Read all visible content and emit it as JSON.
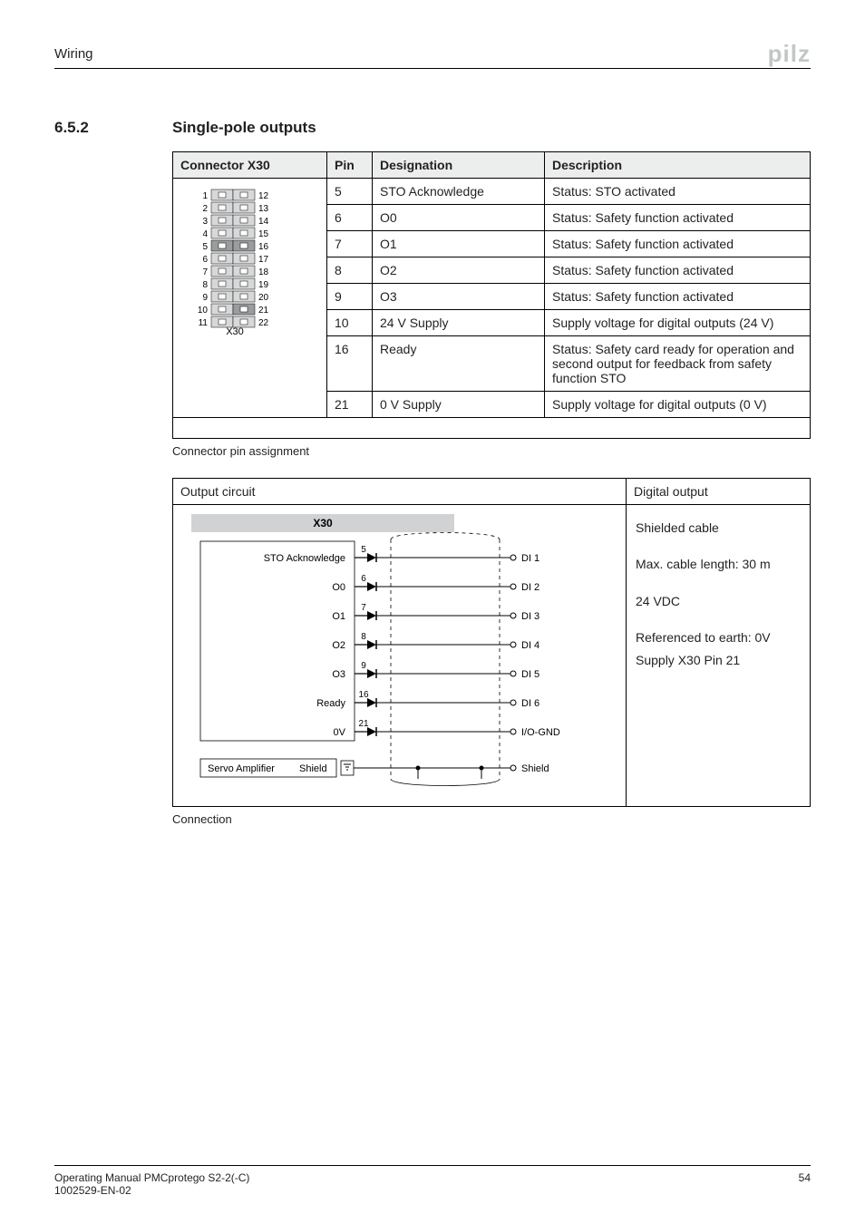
{
  "header": {
    "section": "Wiring",
    "brand": "pilz"
  },
  "section": {
    "number": "6.5.2",
    "title": "Single-pole outputs"
  },
  "pin_table": {
    "headers": [
      "Connector X30",
      "Pin",
      "Designation",
      "Description"
    ],
    "connector_label": "X30",
    "rows": [
      {
        "pin": "5",
        "designation": "STO Acknowledge",
        "description": "Status: STO activated"
      },
      {
        "pin": "6",
        "designation": "O0",
        "description": "Status: Safety function activated"
      },
      {
        "pin": "7",
        "designation": "O1",
        "description": "Status: Safety function activated"
      },
      {
        "pin": "8",
        "designation": "O2",
        "description": "Status: Safety function activated"
      },
      {
        "pin": "9",
        "designation": "O3",
        "description": "Status: Safety function activated"
      },
      {
        "pin": "10",
        "designation": "24 V Supply",
        "description": "Supply voltage for digital outputs (24 V)"
      },
      {
        "pin": "16",
        "designation": "Ready",
        "description": "Status: Safety card ready for operation and second output for feedback from safety function STO"
      },
      {
        "pin": "21",
        "designation": "0 V Supply",
        "description": "Supply voltage for digital outputs (0 V)"
      }
    ],
    "caption": "Connector pin assignment",
    "connector_pins_left": [
      "1",
      "2",
      "3",
      "4",
      "5",
      "6",
      "7",
      "8",
      "9",
      "10",
      "11"
    ],
    "connector_pins_right": [
      "12",
      "13",
      "14",
      "15",
      "16",
      "17",
      "18",
      "19",
      "20",
      "21",
      "22"
    ],
    "connector_highlighted": [
      "5",
      "16",
      "21"
    ]
  },
  "output_circuit": {
    "left_header": "Output circuit",
    "right_header": "Digital output",
    "x30_label": "X30",
    "signals": [
      {
        "name": "STO Acknowledge",
        "pin": "5",
        "to": "DI 1"
      },
      {
        "name": "O0",
        "pin": "6",
        "to": "DI 2"
      },
      {
        "name": "O1",
        "pin": "7",
        "to": "DI 3"
      },
      {
        "name": "O2",
        "pin": "8",
        "to": "DI 4"
      },
      {
        "name": "O3",
        "pin": "9",
        "to": "DI 5"
      },
      {
        "name": "Ready",
        "pin": "16",
        "to": "DI 6"
      },
      {
        "name": "0V",
        "pin": "21",
        "to": "I/O-GND"
      }
    ],
    "shield_left": "Servo Amplifier",
    "shield_box": "Shield",
    "shield_right": "Shield",
    "right_info": {
      "line1": "Shielded cable",
      "line2": "Max. cable length: 30 m",
      "line3": "24 VDC",
      "line4": "Referenced to earth: 0V",
      "line5": "Supply X30 Pin 21"
    },
    "caption": "Connection"
  },
  "footer": {
    "line1": "Operating Manual PMCprotego S2-2(-C)",
    "line2": "1002529-EN-02",
    "page": "54"
  }
}
